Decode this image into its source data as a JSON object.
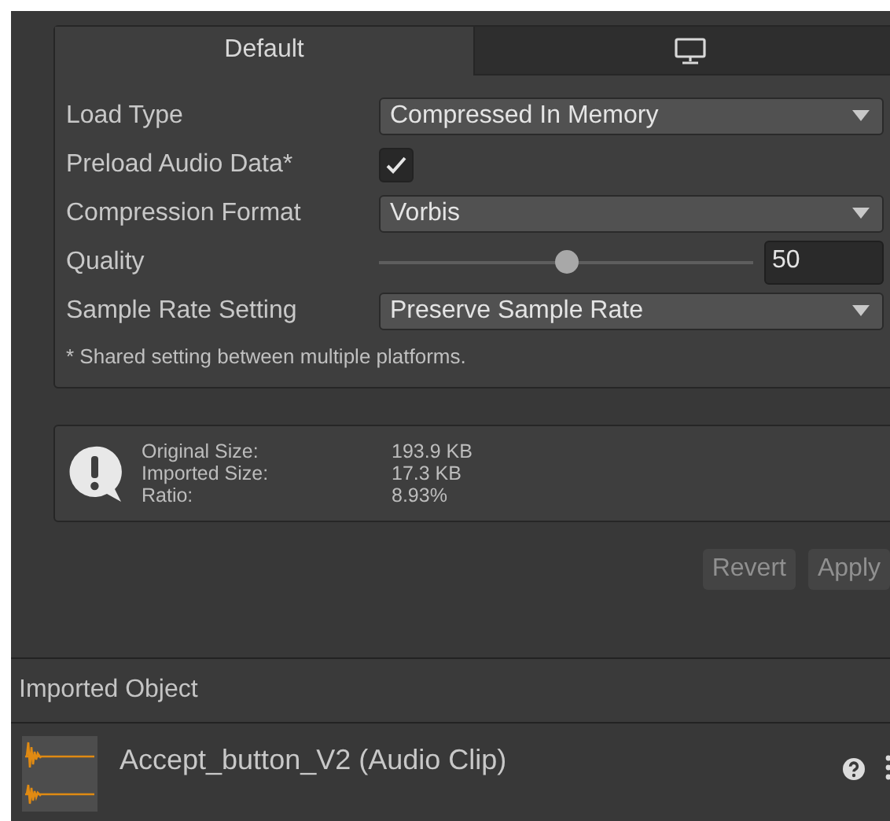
{
  "tabs": [
    {
      "label": "Default",
      "selected": true
    },
    {
      "selected": false
    }
  ],
  "settings": [
    {
      "kind": "dropdown",
      "label": "Load Type",
      "value": "Compressed In Memory"
    },
    {
      "kind": "checkbox",
      "label": "Preload Audio Data*",
      "checked": true
    },
    {
      "kind": "dropdown",
      "label": "Compression Format",
      "value": "Vorbis"
    },
    {
      "kind": "slider",
      "label": "Quality",
      "level": 0.5,
      "value": "50"
    },
    {
      "kind": "dropdown",
      "label": "Sample Rate Setting",
      "value": "Preserve Sample Rate"
    }
  ],
  "footnote": "* Shared setting between multiple platforms.",
  "info": [
    {
      "label": "Original Size:",
      "value": "193.9 KB"
    },
    {
      "label": "Imported Size:",
      "value": "17.3 KB"
    },
    {
      "label": "Ratio:",
      "value": "8.93%"
    }
  ],
  "buttons": [
    "Revert",
    "Apply"
  ],
  "imported_object": {
    "header": "Imported Object",
    "title": "Accept_button_V2 (Audio Clip)"
  }
}
